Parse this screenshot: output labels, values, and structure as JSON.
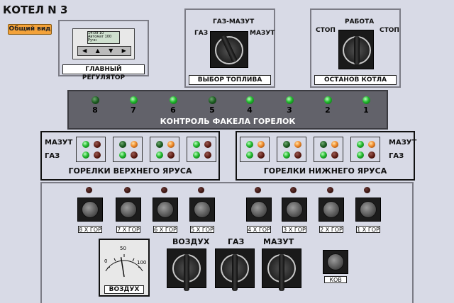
{
  "header": {
    "title": "КОТЕЛ N 3",
    "view_button": "Общий вид"
  },
  "regulator": {
    "caption": "ГЛАВНЫЙ РЕГУЛЯТОР",
    "display_lines": [
      "14:09 10",
      "Автомат 100",
      "Ручн"
    ],
    "keys": [
      "◀",
      "▲",
      "▼",
      "▶"
    ]
  },
  "fuel_select": {
    "caption": "ВЫБОР ТОПЛИВА",
    "left": "ГАЗ",
    "center": "ГАЗ-МАЗУТ",
    "right": "МАЗУТ"
  },
  "boiler_stop": {
    "caption": "ОСТАНОВ КОТЛА",
    "left": "СТОП",
    "center": "РАБОТА",
    "right": "СТОП"
  },
  "flame_control": {
    "caption": "КОНТРОЛЬ ФАКЕЛА ГОРЕЛОК",
    "burners": [
      {
        "num": "8",
        "state": "dark"
      },
      {
        "num": "7",
        "state": "on"
      },
      {
        "num": "6",
        "state": "on"
      },
      {
        "num": "5",
        "state": "dark"
      },
      {
        "num": "4",
        "state": "on"
      },
      {
        "num": "3",
        "state": "on"
      },
      {
        "num": "2",
        "state": "on"
      },
      {
        "num": "1",
        "state": "on"
      }
    ]
  },
  "upper_tier": {
    "caption": "ГОРЕЛКИ ВЕРХНЕГО ЯРУСА",
    "row_top": "МАЗУТ",
    "row_bottom": "ГАЗ"
  },
  "lower_tier": {
    "caption": "ГОРЕЛКИ НИЖНЕГО ЯРУСА",
    "row_top": "МАЗУТ",
    "row_bottom": "ГАЗ"
  },
  "ignition": {
    "buttons": [
      "8 Х ГОР",
      "7 Х ГОР",
      "6 Х ГОР",
      "5 Х ГОР",
      "4 Х ГОР",
      "3 Х ГОР",
      "2 Х ГОР",
      "1 Х ГОР"
    ]
  },
  "gauge": {
    "caption": "ВОЗДУХ",
    "scale": [
      "0",
      "50",
      "100"
    ],
    "value": 45
  },
  "switches": {
    "air": "ВОЗДУХ",
    "gas": "ГАЗ",
    "fuel_oil": "МАЗУТ"
  },
  "kov": {
    "caption": "КОВ"
  },
  "colors": {
    "panel_dark": "#62626a",
    "caption_bg": "#ffffff",
    "button_accent": "#f3a23a"
  }
}
